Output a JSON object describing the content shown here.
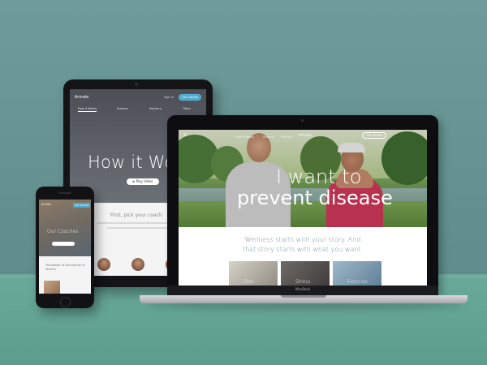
{
  "tablet": {
    "logo": "Arivale",
    "signin": "Sign in",
    "get_started": "Get Started",
    "tabs": [
      "How it Works",
      "Science",
      "Partners",
      "More"
    ],
    "heading": "How it Works",
    "play_label": "Play Video",
    "subheading": "First, pick your coach."
  },
  "phone": {
    "logo": "Arivale",
    "get_started": "Get Started",
    "heading": "Our Coaches",
    "text": "Hundreds of thousands of stories"
  },
  "laptop": {
    "nav_links": [
      "How it Works",
      "Science",
      "Partners"
    ],
    "logo": "Arivale",
    "cta": "Get Started",
    "headline_line1": "I want to",
    "headline_line2": "prevent disease",
    "tagline_line1": "Wellness starts with your story. And",
    "tagline_line2": "that story starts with what you want.",
    "cards": [
      "Diet",
      "Stress",
      "Exercise"
    ],
    "brand": "MacBook"
  }
}
